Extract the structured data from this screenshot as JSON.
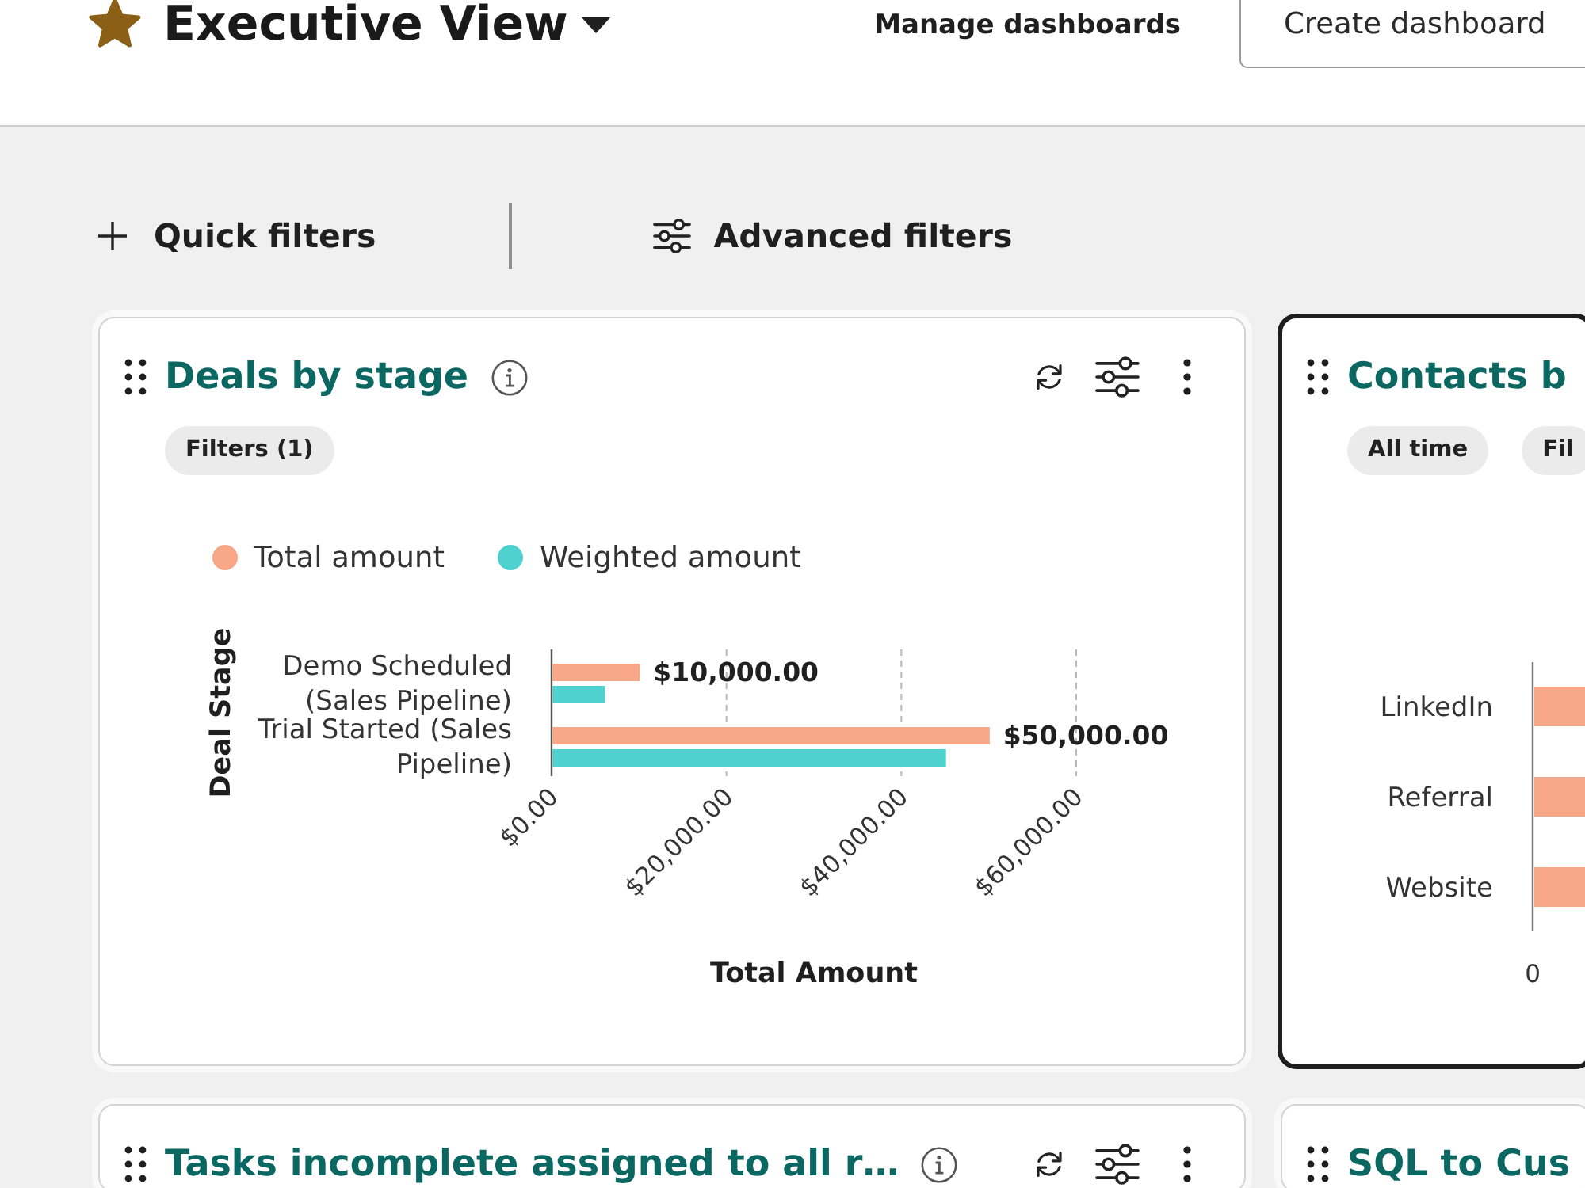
{
  "header": {
    "title": "Executive View",
    "starred": true,
    "buttons": [
      {
        "label": "Manage dashboards",
        "kind": "text"
      },
      {
        "label": "Create dashboard",
        "kind": "outline"
      }
    ]
  },
  "filter_bar": [
    {
      "label": "Quick filters",
      "kind": "add"
    },
    {
      "label": "Advanced filters",
      "kind": "advanced"
    }
  ],
  "cards": [
    {
      "title": "Deals by stage",
      "selected": false,
      "tools": true,
      "chips": [
        "Filters (1)"
      ],
      "chart_data": {
        "type": "bar",
        "orientation": "horizontal",
        "legend": "top",
        "xlabel": "Total Amount",
        "ylabel": "Deal Stage",
        "categories": [
          "Demo Scheduled (Sales Pipeline)",
          "Trial Started (Sales Pipeline)"
        ],
        "series": [
          {
            "name": "Total amount",
            "color": "#f8a888",
            "values": [
              10000,
              50000
            ]
          },
          {
            "name": "Weighted amount",
            "color": "#4fd1cf",
            "values": [
              6000,
              45000
            ]
          }
        ],
        "xlim": [
          0,
          60000
        ],
        "xticks": [
          {
            "value": 0,
            "label": "$0.00"
          },
          {
            "value": 20000,
            "label": "$20,000.00"
          },
          {
            "value": 40000,
            "label": "$40,000.00"
          },
          {
            "value": 60000,
            "label": "$60,000.00"
          }
        ],
        "value_labels": [
          "$10,000.00",
          "$50,000.00"
        ]
      }
    },
    {
      "title": "Contacts b",
      "selected": true,
      "chips": [
        "All time",
        "Fil"
      ],
      "bar_labels": [
        "LinkedIn",
        "Referral",
        "Website"
      ],
      "axis_tick": "0"
    },
    {
      "title": "Tasks incomplete assigned to all r…",
      "selected": false,
      "tools": true
    },
    {
      "title": "SQL to Cus",
      "selected": false
    }
  ]
}
